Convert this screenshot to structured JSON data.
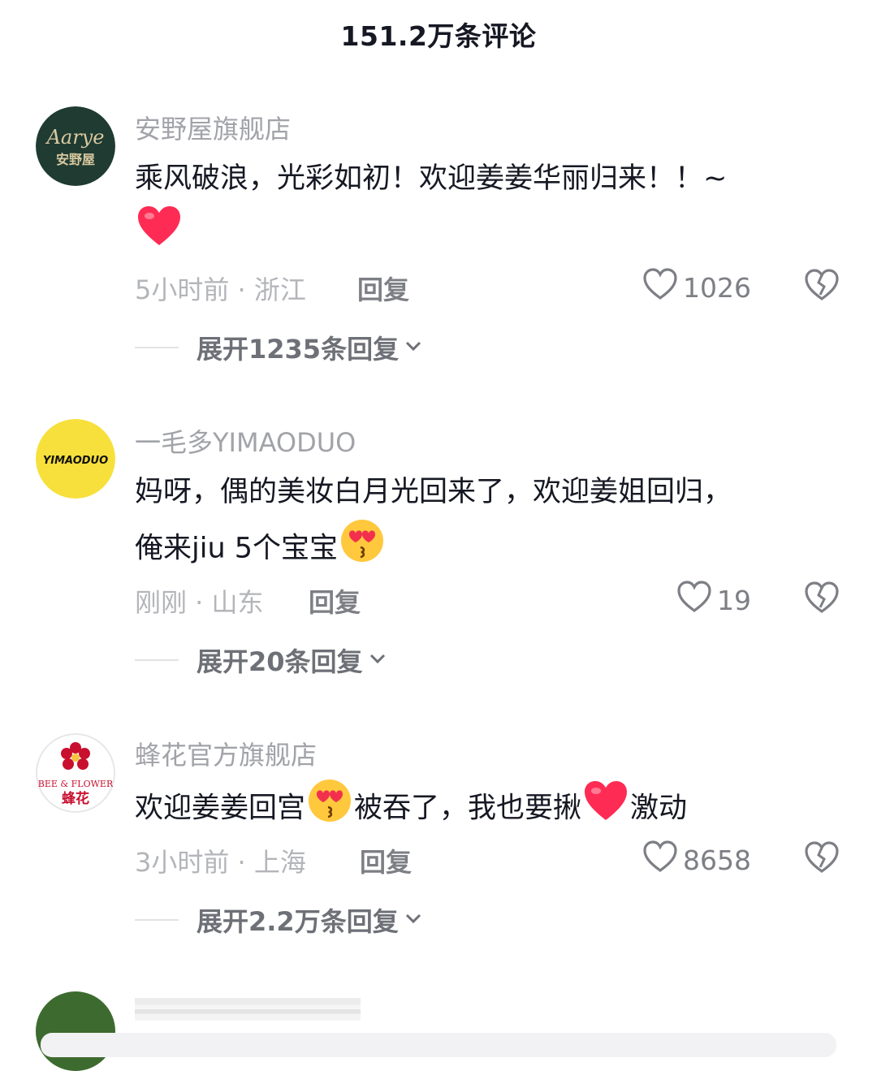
{
  "header": {
    "title": "151.2万条评论"
  },
  "comments": [
    {
      "username": "安野屋旗舰店",
      "avatar_text": "Aarye",
      "avatar_sub": "安野屋",
      "line1": "乘风破浪，光彩如初！欢迎姜姜华丽归来！！~",
      "time_location": "5小时前 · 浙江",
      "reply": "回复",
      "likes": "1026",
      "expand": "展开1235条回复"
    },
    {
      "username": "一毛多YIMAODUO",
      "avatar_text": "YIMAODUO",
      "line1": "妈呀，偶的美妆白月光回来了，欢迎姜姐回归，",
      "line2": "俺来jiu 5个宝宝",
      "time_location": "刚刚 · 山东",
      "reply": "回复",
      "likes": "19",
      "expand": "展开20条回复"
    },
    {
      "username": "蜂花官方旗舰店",
      "avatar_text": "BEE & FLOWER",
      "avatar_sub": "蜂花",
      "seg1": "欢迎姜姜回宫",
      "seg2": "被吞了，我也要揪",
      "seg3": "激动",
      "time_location": "3小时前 · 上海",
      "reply": "回复",
      "likes": "8658",
      "expand": "展开2.2万条回复"
    }
  ],
  "icons": {
    "heart_emoji": "red-heart-icon",
    "kiss_emoji": "heart-eyes-kiss-icon",
    "like": "heart-outline-icon",
    "dislike": "broken-heart-icon",
    "chevron": "chevron-down-icon"
  },
  "colors": {
    "text": "#161823",
    "muted": "#a1a3a8",
    "red_heart": "#fe2c55",
    "emoji_yellow": "#ffc83d"
  }
}
